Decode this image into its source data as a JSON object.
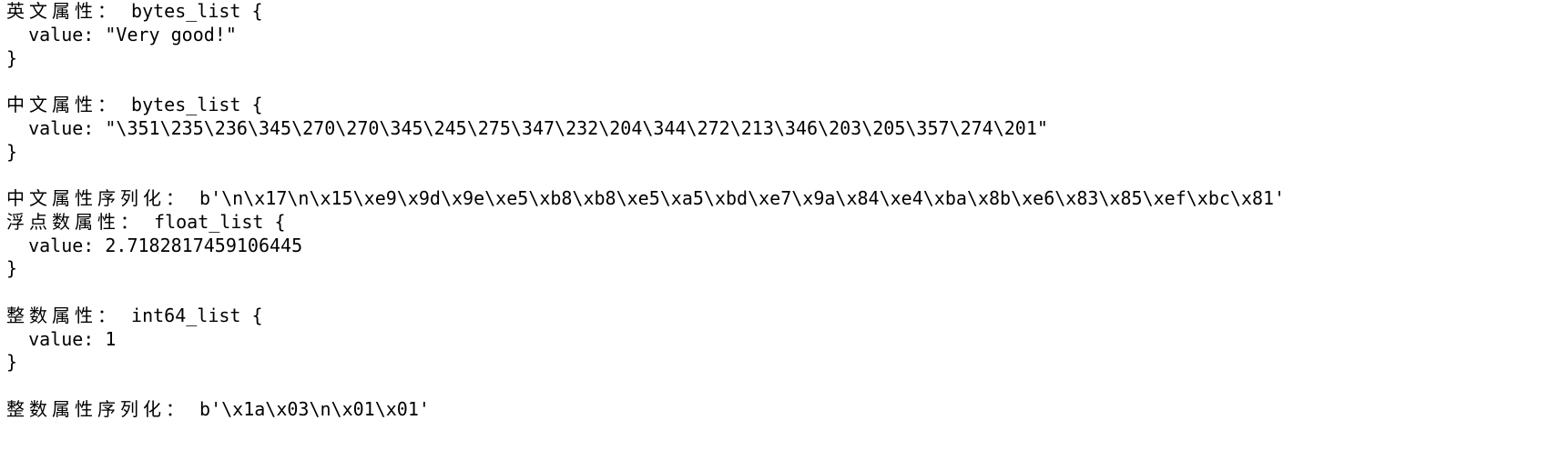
{
  "output": {
    "en_attr": {
      "label": "英文属性：",
      "header": " bytes_list {",
      "value_line": "  value: \"Very good!\"",
      "close": "}"
    },
    "zh_attr": {
      "label": "中文属性：",
      "header": " bytes_list {",
      "value_line": "  value: \"\\351\\235\\236\\345\\270\\270\\345\\245\\275\\347\\232\\204\\344\\272\\213\\346\\203\\205\\357\\274\\201\"",
      "close": "}"
    },
    "zh_serialized": {
      "label": "中文属性序列化：",
      "text": " b'\\n\\x17\\n\\x15\\xe9\\x9d\\x9e\\xe5\\xb8\\xb8\\xe5\\xa5\\xbd\\xe7\\x9a\\x84\\xe4\\xba\\x8b\\xe6\\x83\\x85\\xef\\xbc\\x81'"
    },
    "float_attr": {
      "label": "浮点数属性：",
      "header": " float_list {",
      "value_line": "  value: 2.7182817459106445",
      "close": "}"
    },
    "int_attr": {
      "label": "整数属性：",
      "header": " int64_list {",
      "value_line": "  value: 1",
      "close": "}"
    },
    "int_serialized": {
      "label": "整数属性序列化：",
      "text": " b'\\x1a\\x03\\n\\x01\\x01'"
    }
  }
}
